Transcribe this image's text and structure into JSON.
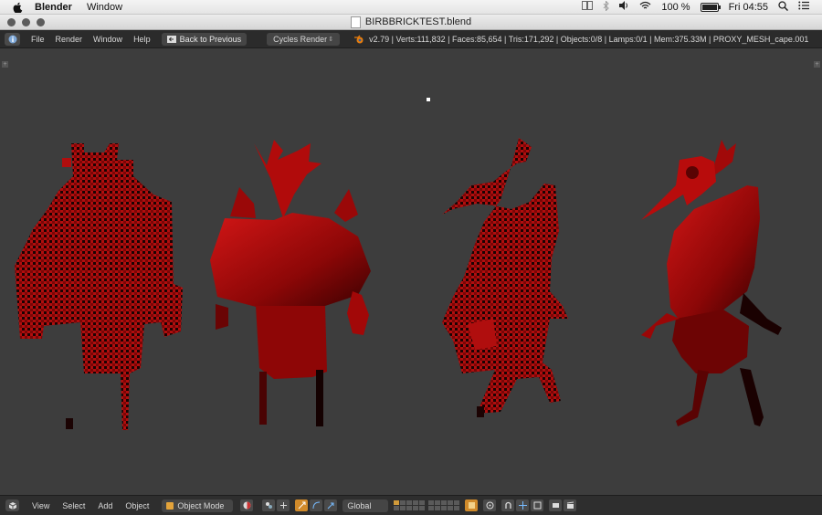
{
  "macos": {
    "app_name": "Blender",
    "menus": [
      "Window"
    ],
    "battery_percent": "100 %",
    "clock": "Fri 04:55",
    "battery_level": 1.0
  },
  "window": {
    "title": "BIRBBRICKTEST.blend"
  },
  "info_header": {
    "menus": [
      "File",
      "Render",
      "Window",
      "Help"
    ],
    "back_button": "Back to Previous",
    "render_engine": "Cycles Render",
    "stats": "v2.79 | Verts:111,832 | Faces:85,654 | Tris:171,292 | Objects:0/8 | Lamps:0/1 | Mem:375.33M | PROXY_MESH_cape.001"
  },
  "view_header": {
    "menus": [
      "View",
      "Select",
      "Add",
      "Object"
    ],
    "mode": "Object Mode",
    "orientation": "Global"
  },
  "viewport": {
    "background": "#3d3d3d",
    "mesh_color": "#c01010",
    "shadow_color": "#1a0202",
    "figures": [
      "voxel-horned-figure",
      "lowpoly-horned-figure",
      "voxel-bird-figure",
      "lowpoly-bird-figure"
    ]
  }
}
